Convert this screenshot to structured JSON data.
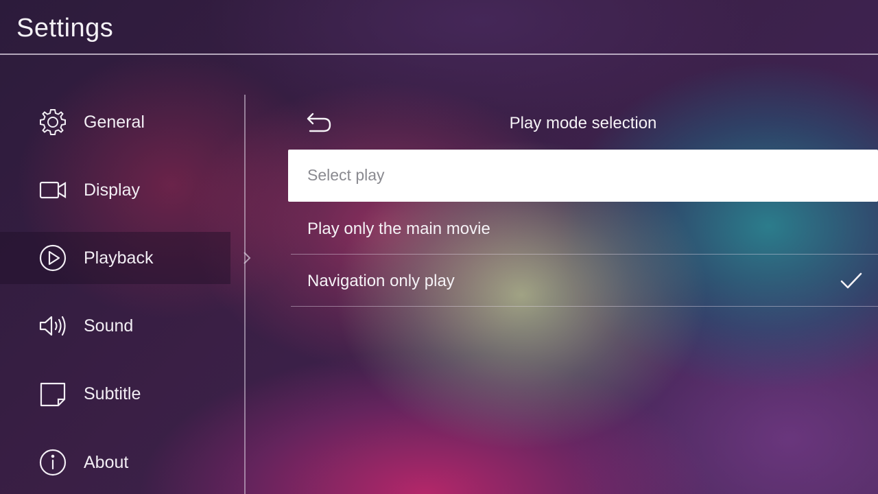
{
  "header": {
    "title": "Settings"
  },
  "sidebar": {
    "items": [
      {
        "label": "General",
        "icon": "gear-icon"
      },
      {
        "label": "Display",
        "icon": "display-icon"
      },
      {
        "label": "Playback",
        "icon": "play-icon",
        "selected": true
      },
      {
        "label": "Sound",
        "icon": "speaker-icon"
      },
      {
        "label": "Subtitle",
        "icon": "subtitle-icon"
      },
      {
        "label": "About",
        "icon": "info-icon"
      }
    ]
  },
  "panel": {
    "title": "Play mode selection",
    "back_icon": "back-arrow-icon",
    "select_placeholder": "Select play",
    "options": [
      {
        "label": "Play only the main movie",
        "checked": false
      },
      {
        "label": "Navigation only play",
        "checked": true
      }
    ]
  },
  "colors": {
    "text": "#f2eef4",
    "highlight_bar": "#ffffff",
    "placeholder_text": "#8a8a90"
  }
}
